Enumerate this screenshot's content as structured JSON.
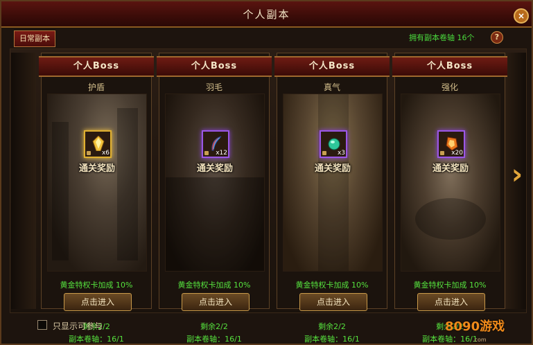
{
  "window": {
    "title": "个人副本",
    "close_icon": "close-icon"
  },
  "tab": {
    "label": "日常副本"
  },
  "header": {
    "scroll_count": "拥有副本卷轴 16个",
    "help": "?"
  },
  "cards": [
    {
      "header": "个人Boss",
      "subtitle": "护盾",
      "item_count": "x6",
      "reward_label": "通关奖励",
      "bonus": "黄金特权卡加成 10%",
      "enter_label": "点击进入",
      "remaining": "剩余2/2",
      "scroll_use": "副本卷轴：16/1",
      "item_icon": "shield-crystal-icon",
      "item_frame": "gold"
    },
    {
      "header": "个人Boss",
      "subtitle": "羽毛",
      "item_count": "x12",
      "reward_label": "通关奖励",
      "bonus": "黄金特权卡加成 10%",
      "enter_label": "点击进入",
      "remaining": "剩余2/2",
      "scroll_use": "副本卷轴：16/1",
      "item_icon": "feather-icon",
      "item_frame": "purple"
    },
    {
      "header": "个人Boss",
      "subtitle": "真气",
      "item_count": "x3",
      "reward_label": "通关奖励",
      "bonus": "黄金特权卡加成 10%",
      "enter_label": "点击进入",
      "remaining": "剩余2/2",
      "scroll_use": "副本卷轴：16/1",
      "item_icon": "jade-orb-icon",
      "item_frame": "purple"
    },
    {
      "header": "个人Boss",
      "subtitle": "强化",
      "item_count": "x20",
      "reward_label": "通关奖励",
      "bonus": "黄金特权卡加成 10%",
      "enter_label": "点击进入",
      "remaining": "剩余2/2",
      "scroll_use": "副本卷轴：16/1",
      "item_icon": "fire-stone-icon",
      "item_frame": "purple"
    }
  ],
  "footer": {
    "checkbox_label": "只显示可参与",
    "checked": false
  },
  "next_arrow": "chevron-right-icon",
  "watermark": {
    "text": "8090游戏",
    "sub": ".com"
  }
}
